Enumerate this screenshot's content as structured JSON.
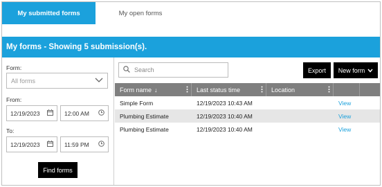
{
  "tabs": [
    {
      "label": "My submitted forms",
      "active": true
    },
    {
      "label": "My open forms",
      "active": false
    }
  ],
  "header": {
    "title": "My forms - Showing 5 submission(s)."
  },
  "filters": {
    "form_label": "Form:",
    "form_value": "All forms",
    "from_label": "From:",
    "from_date": "12/19/2023",
    "from_time": "12:00 AM",
    "to_label": "To:",
    "to_date": "12/19/2023",
    "to_time": "11:59 PM",
    "find_label": "Find forms"
  },
  "toolbar": {
    "search_placeholder": "Search",
    "export_label": "Export",
    "new_form_label": "New form"
  },
  "table": {
    "columns": [
      "Form name",
      "Last status time",
      "Location"
    ],
    "sort_indicator": "↓",
    "rows": [
      {
        "form_name": "Simple Form",
        "last_status_time": "12/19/2023 10:43 AM",
        "location": "",
        "action": "View"
      },
      {
        "form_name": "Plumbing Estimate",
        "last_status_time": "12/19/2023 10:40 AM",
        "location": "",
        "action": "View"
      },
      {
        "form_name": "Plumbing Estimate",
        "last_status_time": "12/19/2023 10:40 AM",
        "location": "",
        "action": "View"
      }
    ]
  },
  "colors": {
    "accent": "#1ba1dc",
    "header_gray": "#7f7f7f",
    "row_alt": "#e6e6e6"
  },
  "icons": [
    "search-icon",
    "calendar-icon",
    "clock-icon",
    "chevron-down-icon",
    "column-menu-icon"
  ]
}
